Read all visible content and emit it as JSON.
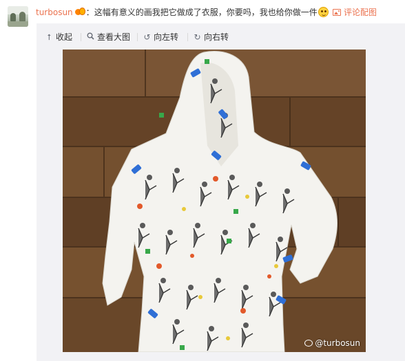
{
  "comment": {
    "username": "turbosun",
    "colon": "：",
    "text": "这幅有意义的画我把它做成了衣服，你要吗，我也给你做一件",
    "badge_icon": "vip-badge-icon",
    "emoji_icon": "smile-emoji-icon",
    "pic_link": "评论配图",
    "pic_icon": "picture-icon"
  },
  "toolbar": {
    "collapse": {
      "label": "收起",
      "icon": "arrow-up-icon"
    },
    "view_large": {
      "label": "查看大图",
      "icon": "magnifier-icon"
    },
    "rotate_left": {
      "label": "向左转",
      "icon": "rotate-left-icon"
    },
    "rotate_right": {
      "label": "向右转",
      "icon": "rotate-right-icon"
    }
  },
  "image": {
    "watermark": "@turbosun",
    "watermark_icon": "weibo-logo-icon"
  },
  "colors": {
    "accent": "#eb7350",
    "panel_bg": "#f2f2f5",
    "text": "#333333",
    "floor": "#6b4a2f",
    "hoodie": "#f4f3ef"
  }
}
